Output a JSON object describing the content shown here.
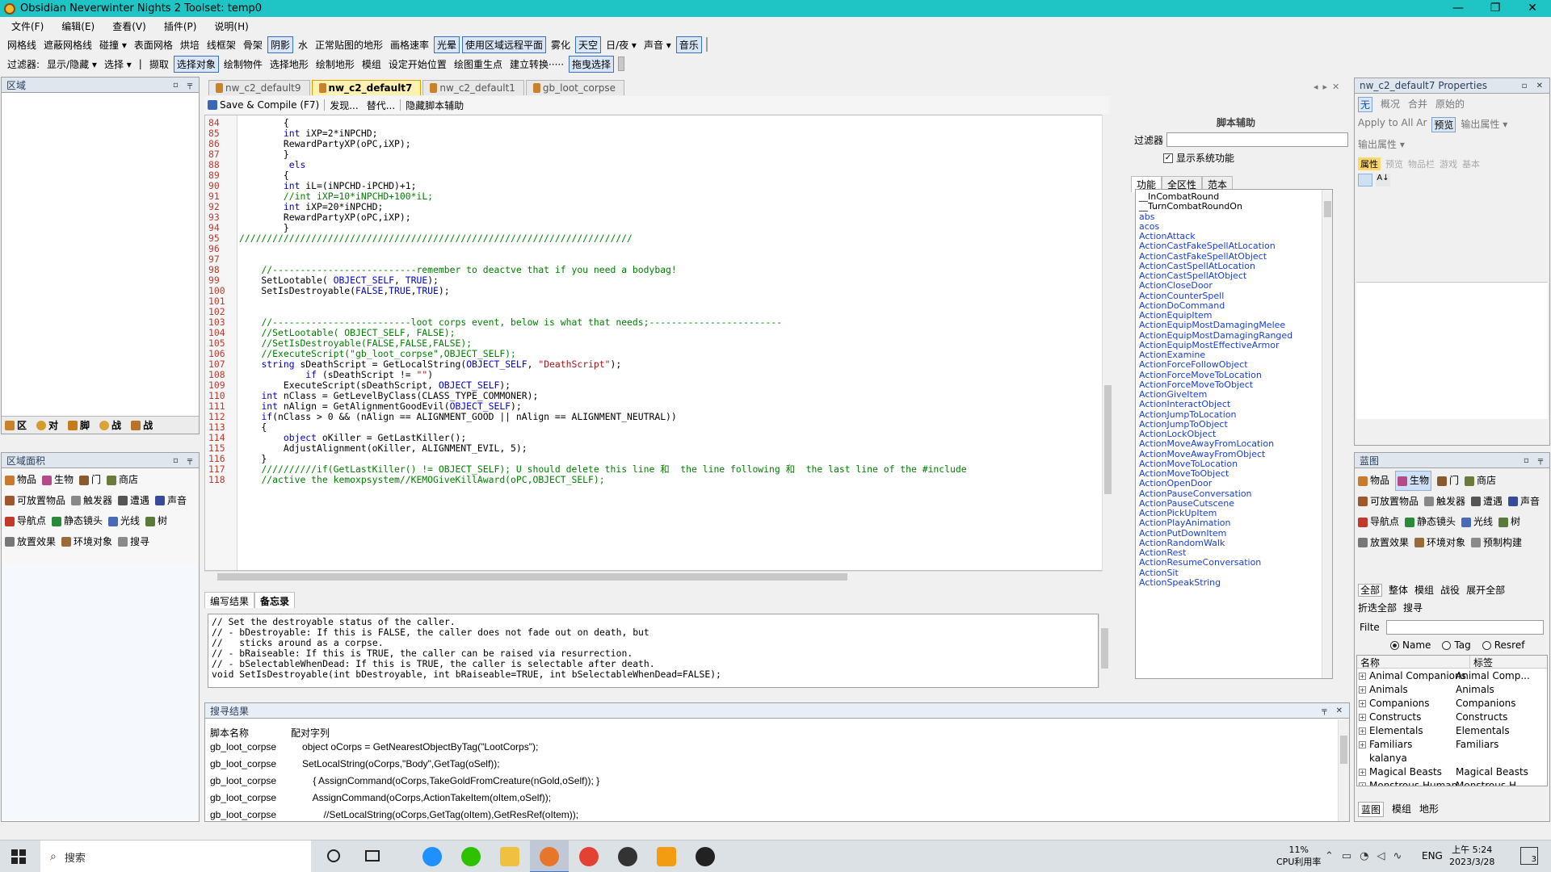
{
  "window": {
    "title": "Obsidian Neverwinter Nights 2 Toolset: temp0",
    "min": "—",
    "max": "❐",
    "close": "✕"
  },
  "menu": [
    "文件(F)",
    "编辑(E)",
    "查看(V)",
    "插件(P)",
    "说明(H)"
  ],
  "toolbar1": [
    {
      "label": "网格线",
      "on": false
    },
    {
      "label": "遮蔽网格线",
      "on": false
    },
    {
      "label": "碰撞 ▾",
      "on": false
    },
    {
      "label": "表面网格",
      "on": false
    },
    {
      "label": "烘培",
      "on": false
    },
    {
      "label": "线框架",
      "on": false
    },
    {
      "label": "骨架",
      "on": false
    },
    {
      "label": "阴影",
      "on": true
    },
    {
      "label": "水",
      "on": false
    },
    {
      "label": "正常贴图的地形",
      "on": false
    },
    {
      "label": "画格速率",
      "on": false
    },
    {
      "label": "光晕",
      "on": true
    },
    {
      "label": "使用区域远程平面",
      "on": true
    },
    {
      "label": "雾化",
      "on": false
    },
    {
      "label": "天空",
      "on": true
    },
    {
      "label": "日/夜 ▾",
      "on": false
    },
    {
      "label": "声音 ▾",
      "on": false
    },
    {
      "label": "音乐",
      "on": true
    }
  ],
  "toolbar2": [
    {
      "label": "过滤器:",
      "on": false
    },
    {
      "label": "显示/隐藏 ▾",
      "on": false
    },
    {
      "label": "选择 ▾",
      "on": false
    },
    {
      "label": "|",
      "on": false
    },
    {
      "label": "撷取",
      "on": false
    },
    {
      "label": "选择对象",
      "on": true
    },
    {
      "label": "绘制物件",
      "on": false
    },
    {
      "label": "选择地形",
      "on": false
    },
    {
      "label": "绘制地形",
      "on": false
    },
    {
      "label": "模组",
      "on": false
    },
    {
      "label": "设定开始位置",
      "on": false
    },
    {
      "label": "绘图重生点",
      "on": false
    },
    {
      "label": "建立转换·····",
      "on": false
    },
    {
      "label": "拖曳选择",
      "on": true
    }
  ],
  "area_panel": {
    "title": "区域",
    "tabs": [
      "区",
      "对",
      "脚",
      "战",
      "战"
    ]
  },
  "palette_panel": {
    "title": "区域面积",
    "items": [
      "物品",
      "生物",
      "门",
      "商店",
      "可放置物品",
      "触发器",
      "遭遇",
      "声音",
      "导航点",
      "静态镜头",
      "光线",
      "树",
      "放置效果",
      "环境对象",
      "搜寻"
    ]
  },
  "editor": {
    "tabs": [
      "nw_c2_default9",
      "nw_c2_default7",
      "nw_c2_default1",
      "gb_loot_corpse"
    ],
    "active_tab": 1,
    "toolbar": [
      "Save & Compile (F7)",
      "发现...",
      "替代...",
      "隐藏脚本辅助"
    ],
    "lines": [
      {
        "n": "84",
        "t": "        {"
      },
      {
        "n": "85",
        "t": "        int iXP=2*iNPCHD;"
      },
      {
        "n": "86",
        "t": "        RewardPartyXP(oPC,iXP);"
      },
      {
        "n": "87",
        "t": "        }"
      },
      {
        "n": "88",
        "t": "         els"
      },
      {
        "n": "89",
        "t": "        {"
      },
      {
        "n": "90",
        "t": "        int iL=(iNPCHD-iPCHD)+1;"
      },
      {
        "n": "91",
        "t": "        //int iXP=10*iNPCHD+100*iL;"
      },
      {
        "n": "92",
        "t": "        int iXP=20*iNPCHD;"
      },
      {
        "n": "93",
        "t": "        RewardPartyXP(oPC,iXP);"
      },
      {
        "n": "94",
        "t": "        }"
      },
      {
        "n": "95",
        "t": "///////////////////////////////////////////////////////////////////////"
      },
      {
        "n": "96",
        "t": ""
      },
      {
        "n": "97",
        "t": ""
      },
      {
        "n": "98",
        "t": "    //--------------------------remember to deactve that if you need a bodybag!"
      },
      {
        "n": "99",
        "t": "    SetLootable( OBJECT_SELF, TRUE);"
      },
      {
        "n": "100",
        "t": "    SetIsDestroyable(FALSE,TRUE,TRUE);"
      },
      {
        "n": "101",
        "t": ""
      },
      {
        "n": "102",
        "t": ""
      },
      {
        "n": "103",
        "t": "    //-------------------------loot corps event, below is what that needs;------------------------"
      },
      {
        "n": "104",
        "t": "    //SetLootable( OBJECT_SELF, FALSE);"
      },
      {
        "n": "105",
        "t": "    //SetIsDestroyable(FALSE,FALSE,FALSE);"
      },
      {
        "n": "106",
        "t": "    //ExecuteScript(\"gb_loot_corpse\",OBJECT_SELF);"
      },
      {
        "n": "107",
        "t": "    string sDeathScript = GetLocalString(OBJECT_SELF, \"DeathScript\");"
      },
      {
        "n": "108",
        "t": "            if (sDeathScript != \"\")"
      },
      {
        "n": "109",
        "t": "        ExecuteScript(sDeathScript, OBJECT_SELF);"
      },
      {
        "n": "110",
        "t": "    int nClass = GetLevelByClass(CLASS_TYPE_COMMONER);"
      },
      {
        "n": "111",
        "t": "    int nAlign = GetAlignmentGoodEvil(OBJECT_SELF);"
      },
      {
        "n": "112",
        "t": "    if(nClass > 0 && (nAlign == ALIGNMENT_GOOD || nAlign == ALIGNMENT_NEUTRAL))"
      },
      {
        "n": "113",
        "t": "    {"
      },
      {
        "n": "114",
        "t": "        object oKiller = GetLastKiller();"
      },
      {
        "n": "115",
        "t": "        AdjustAlignment(oKiller, ALIGNMENT_EVIL, 5);"
      },
      {
        "n": "116",
        "t": "    }"
      },
      {
        "n": "117",
        "t": "    //////////if(GetLastKiller() != OBJECT_SELF); U should delete this line 和  the line following 和  the last line of the #include"
      },
      {
        "n": "118",
        "t": "    //active the kemoxpsystem//KEMOGiveKillAward(oPC,OBJECT_SELF);"
      }
    ],
    "bottom_tabs": [
      "编写结果",
      "备忘录"
    ],
    "notes": [
      "// Set the destroyable status of the caller.",
      "// - bDestroyable: If this is FALSE, the caller does not fade out on death, but",
      "//   sticks around as a corpse.",
      "// - bRaiseable: If this is TRUE, the caller can be raised via resurrection.",
      "// - bSelectableWhenDead: If this is TRUE, the caller is selectable after death.",
      "void SetIsDestroyable(int bDestroyable, int bRaiseable=TRUE, int bSelectableWhenDead=FALSE);"
    ]
  },
  "script_assist": {
    "title": "脚本辅助",
    "filter_label": "过滤器",
    "filter_value": "",
    "show_sys": "显示系统功能",
    "tabs": [
      "功能",
      "全区性",
      "范本"
    ],
    "functions": [
      "__InCombatRound",
      "__TurnCombatRoundOn",
      "abs",
      "acos",
      "ActionAttack",
      "ActionCastFakeSpellAtLocation",
      "ActionCastFakeSpellAtObject",
      "ActionCastSpellAtLocation",
      "ActionCastSpellAtObject",
      "ActionCloseDoor",
      "ActionCounterSpell",
      "ActionDoCommand",
      "ActionEquipItem",
      "ActionEquipMostDamagingMelee",
      "ActionEquipMostDamagingRanged",
      "ActionEquipMostEffectiveArmor",
      "ActionExamine",
      "ActionForceFollowObject",
      "ActionForceMoveToLocation",
      "ActionForceMoveToObject",
      "ActionGiveItem",
      "ActionInteractObject",
      "ActionJumpToLocation",
      "ActionJumpToObject",
      "ActionLockObject",
      "ActionMoveAwayFromLocation",
      "ActionMoveAwayFromObject",
      "ActionMoveToLocation",
      "ActionMoveToObject",
      "ActionOpenDoor",
      "ActionPauseConversation",
      "ActionPauseCutscene",
      "ActionPickUpItem",
      "ActionPlayAnimation",
      "ActionPutDownItem",
      "ActionRandomWalk",
      "ActionRest",
      "ActionResumeConversation",
      "ActionSit",
      "ActionSpeakString"
    ]
  },
  "search_results": {
    "title": "搜寻结果",
    "col1": "脚本名称",
    "col2": "配对字列",
    "rows": [
      {
        "s": "gb_loot_corpse",
        "m": "object oCorps = GetNearestObjectByTag(\"LootCorps\");"
      },
      {
        "s": "gb_loot_corpse",
        "m": "SetLocalString(oCorps,\"Body\",GetTag(oSelf));"
      },
      {
        "s": "gb_loot_corpse",
        "m": "    { AssignCommand(oCorps,TakeGoldFromCreature(nGold,oSelf)); }"
      },
      {
        "s": "gb_loot_corpse",
        "m": "    AssignCommand(oCorps,ActionTakeItem(oItem,oSelf));"
      },
      {
        "s": "gb_loot_corpse",
        "m": "        //SetLocalString(oCorps,GetTag(oItem),GetResRef(oItem));"
      }
    ]
  },
  "properties": {
    "title": "nw_c2_default7 Properties",
    "row1": [
      "无",
      "概况",
      "合并",
      "原始的"
    ],
    "row2": [
      "Apply to All Ar",
      "预览",
      "输出属性 ▾"
    ],
    "row3": "输出属性 ▾",
    "tabs": [
      "属性",
      "预览",
      "物品栏",
      "游戏",
      "基本"
    ]
  },
  "blueprints": {
    "title": "蓝图",
    "items": [
      "物品",
      "生物",
      "门",
      "商店",
      "可放置物品",
      "触发器",
      "遭遇",
      "声音",
      "导航点",
      "静态镜头",
      "光线",
      "树",
      "放置效果",
      "环境对象",
      "预制构建"
    ],
    "filters": [
      "全部",
      "整体",
      "模组",
      "战役",
      "展开全部",
      "折迭全部",
      "搜寻"
    ],
    "filter_label": "Filte",
    "radios": [
      "Name",
      "Tag",
      "Resref"
    ],
    "col1": "名称",
    "col2": "标签",
    "rows": [
      {
        "e": true,
        "a": "Animal Companions",
        "b": "Animal Comp..."
      },
      {
        "e": true,
        "a": "Animals",
        "b": "Animals"
      },
      {
        "e": true,
        "a": "Companions",
        "b": "Companions"
      },
      {
        "e": true,
        "a": "Constructs",
        "b": "Constructs"
      },
      {
        "e": true,
        "a": "Elementals",
        "b": "Elementals"
      },
      {
        "e": true,
        "a": "Familiars",
        "b": "Familiars"
      },
      {
        "e": false,
        "a": "kalanya",
        "b": ""
      },
      {
        "e": true,
        "a": "Magical Beasts",
        "b": "Magical Beasts"
      },
      {
        "e": true,
        "a": "Monstrous Human...",
        "b": "Monstrous H..."
      }
    ],
    "bottom_tabs": [
      "蓝图",
      "模组",
      "地形"
    ]
  },
  "taskbar": {
    "search": "搜索",
    "cpu_pct": "11%",
    "cpu_label": "CPU利用率",
    "lang": "ENG",
    "time": "上午 5:24",
    "date": "2023/3/28",
    "notif": "3"
  },
  "colors": {
    "titlebar": "#1ec5c4",
    "accent": "#0a3fbf",
    "link": "#1a40d8",
    "comment": "#008000"
  }
}
